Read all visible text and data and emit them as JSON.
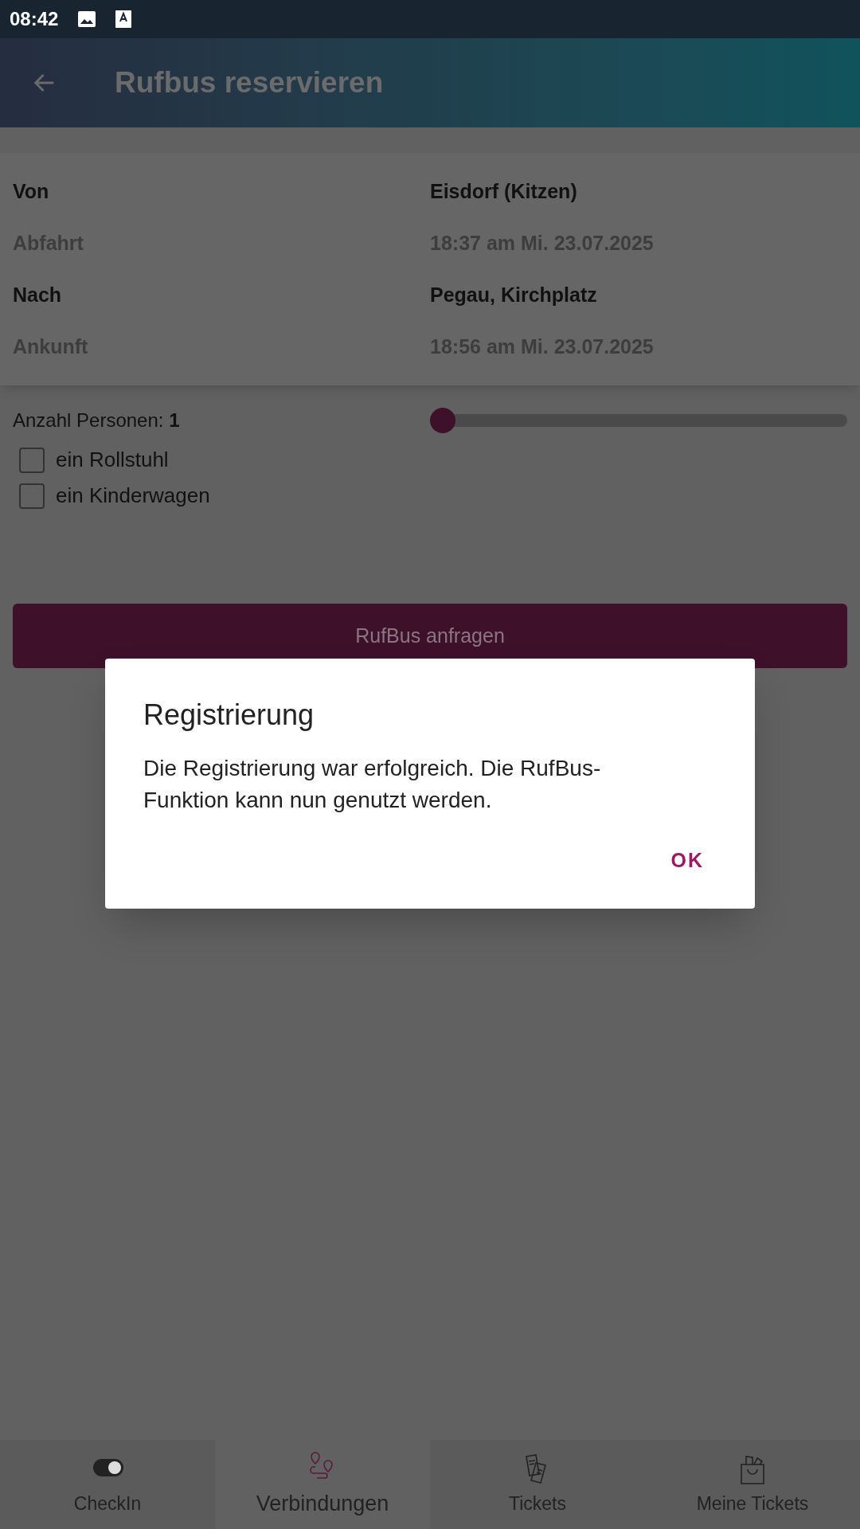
{
  "status_bar": {
    "time": "08:42"
  },
  "app_bar": {
    "title": "Rufbus reservieren"
  },
  "trip": [
    {
      "label": "Von",
      "value": "Eisdorf (Kitzen)",
      "kind": "stop"
    },
    {
      "label": "Abfahrt",
      "value": "18:37 am Mi. 23.07.2025",
      "kind": "time"
    },
    {
      "label": "Nach",
      "value": "Pegau, Kirchplatz",
      "kind": "stop"
    },
    {
      "label": "Ankunft",
      "value": "18:56 am Mi. 23.07.2025",
      "kind": "time"
    }
  ],
  "persons": {
    "label": "Anzahl Personen: **1**",
    "level": 0
  },
  "options": [
    {
      "label": "ein Rollstuhl",
      "checked": false
    },
    {
      "label": "ein Kinderwagen",
      "checked": false
    }
  ],
  "request_button": "RufBus anfragen",
  "dialog": {
    "title": "Registrierung",
    "message": "Die Registrierung war erfolgreich. Die RufBus-Funktion kann nun genutzt werden.",
    "button": "OK"
  },
  "bottom_nav": [
    {
      "label": "CheckIn",
      "kind": "toggle",
      "selected": false
    },
    {
      "label": "Verbindungen",
      "kind": "route",
      "selected": true
    },
    {
      "label": "Tickets",
      "kind": "tickets",
      "selected": false
    },
    {
      "label": "Meine Tickets",
      "kind": "bag",
      "selected": false
    }
  ]
}
